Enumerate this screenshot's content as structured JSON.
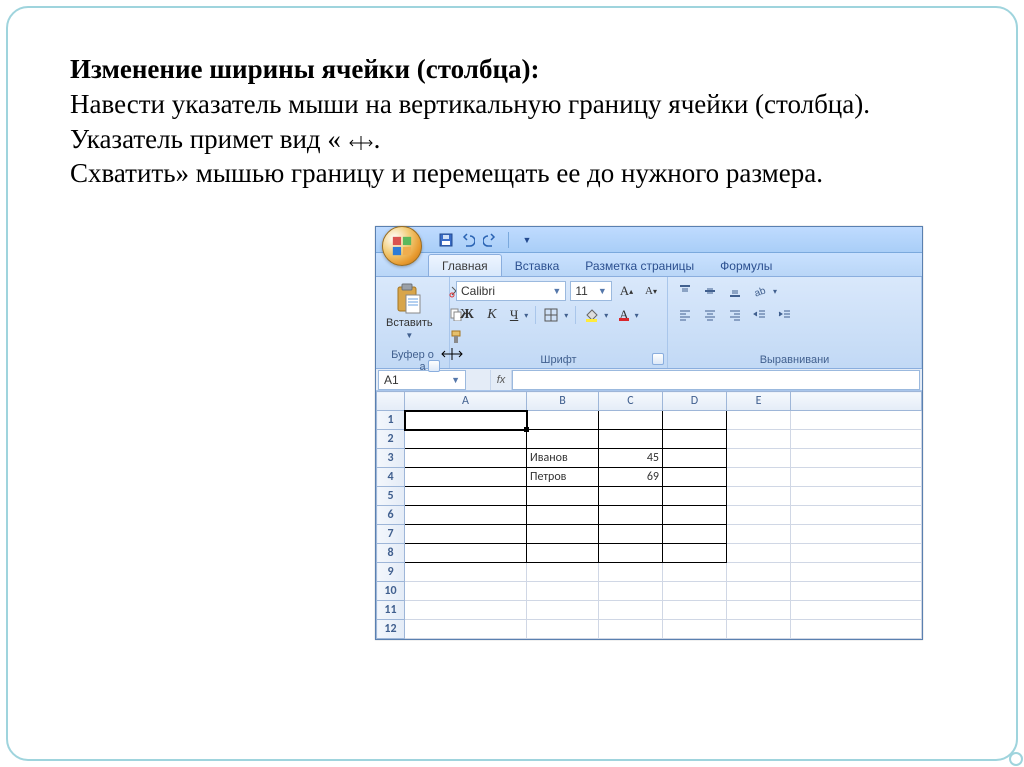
{
  "heading": "Изменение ширины ячейки (столбца):",
  "para1": "Навести указатель мыши на вертикальную границу ячейки (столбца). Указатель примет вид   «",
  "para2": "Схватить» мышью границу и перемещать ее до нужного размера.",
  "excel": {
    "tabs": [
      "Главная",
      "Вставка",
      "Разметка страницы",
      "Формулы"
    ],
    "clipboard": {
      "paste": "Вставить",
      "label": "Буфер о",
      "label2": "а"
    },
    "font": {
      "name": "Calibri",
      "size": "11",
      "label": "Шрифт",
      "bold": "Ж",
      "italic": "К",
      "underline": "Ч",
      "growA": "A",
      "shrinkA": "A"
    },
    "align": {
      "label": "Выравнивани"
    },
    "namebox": "A1",
    "fx": "fx",
    "columns": [
      "A",
      "B",
      "C",
      "D",
      "E"
    ],
    "rows": [
      "1",
      "2",
      "3",
      "4",
      "5",
      "6",
      "7",
      "8",
      "9",
      "10",
      "11",
      "12"
    ],
    "cells": {
      "B3": "Иванов",
      "C3": "45",
      "B4": "Петров",
      "C4": "69"
    }
  }
}
